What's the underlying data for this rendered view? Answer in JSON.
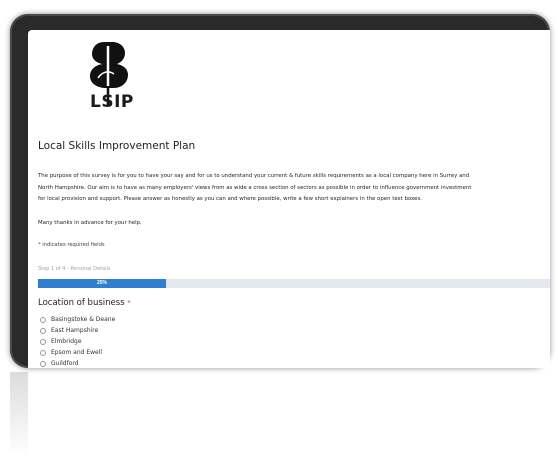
{
  "logo": {
    "icon": "plant-b-logo-icon",
    "text": "LSIP"
  },
  "form": {
    "title": "Local Skills Improvement Plan",
    "intro_lines": [
      "The purpose of this survey is for you to have your say and for us to understand your current & future skills requirements as a local company here in Surrey and",
      "North Hampshire. Our aim is to have as many employers' views from as wide a cross section of sectors as possible in order to influence government investment",
      "for local provision and support. Please answer as honestly as you can and where possible, write a few short explainers in the open text boxes."
    ],
    "thanks": "Many thanks in advance for your help.",
    "required_star": "*",
    "required_note": " indicates required fields",
    "step_label": "Step 1 of 4 - Personal Details",
    "progress_percent": 25,
    "progress_text": "25%",
    "question": {
      "label": "Location of business",
      "required_mark": "*",
      "options": [
        "Basingstoke & Deane",
        "East Hampshire",
        "Elmbridge",
        "Epsom and Ewell",
        "Guildford"
      ]
    }
  },
  "colors": {
    "accent": "#2f7fd0",
    "progress_track": "#e3e8ef",
    "device_frame": "#2a2a2a",
    "required": "#c02020"
  }
}
